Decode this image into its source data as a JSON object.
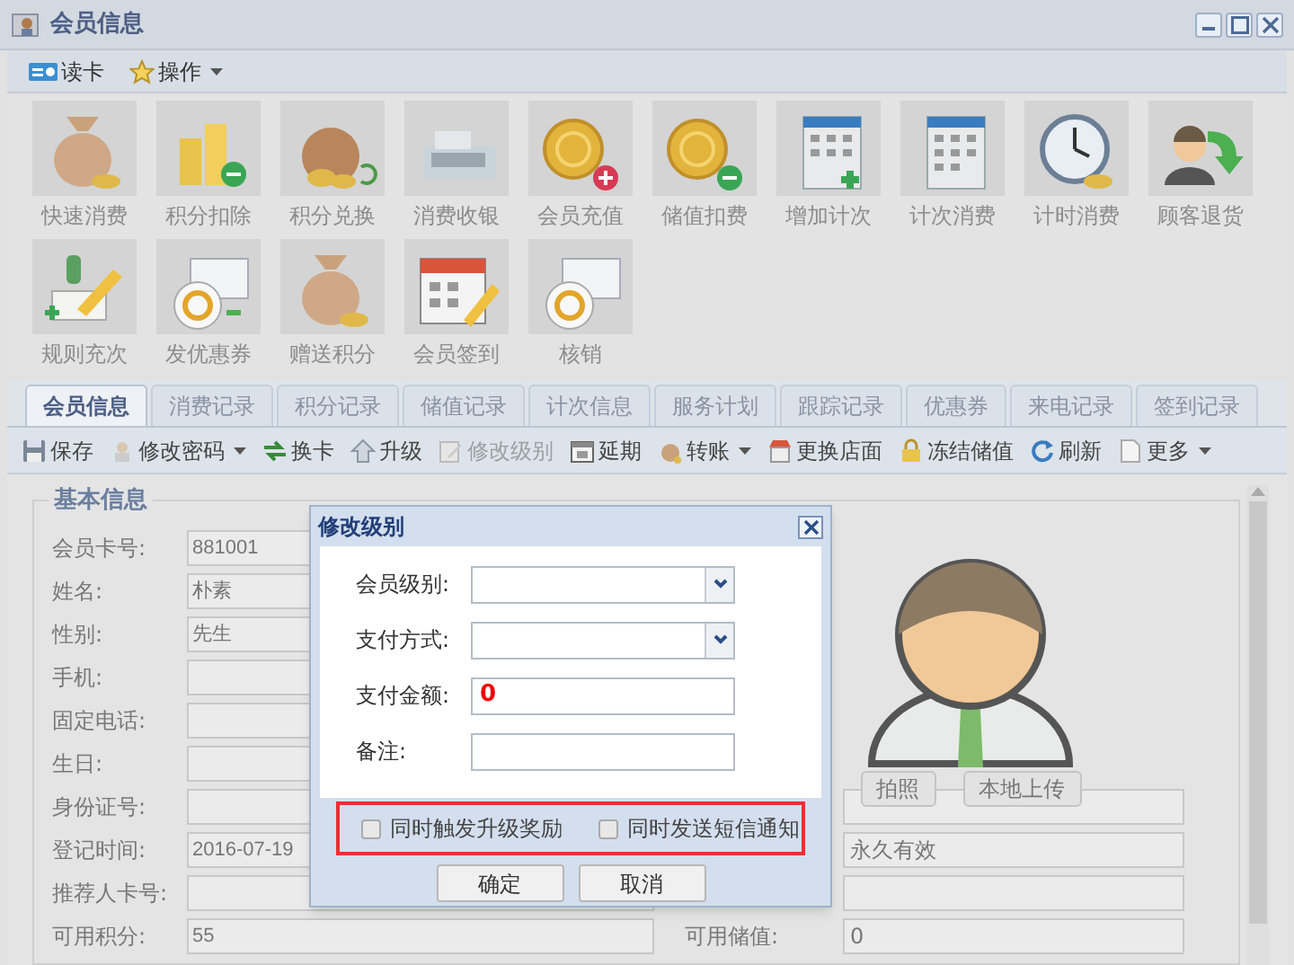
{
  "window": {
    "title": "会员信息"
  },
  "menu": [
    {
      "label": "读卡",
      "dropdown": false
    },
    {
      "label": "操作",
      "dropdown": true
    }
  ],
  "tiles": [
    {
      "label": "快速消费"
    },
    {
      "label": "积分扣除"
    },
    {
      "label": "积分兑换"
    },
    {
      "label": "消费收银"
    },
    {
      "label": "会员充值"
    },
    {
      "label": "储值扣费"
    },
    {
      "label": "增加计次"
    },
    {
      "label": "计次消费"
    },
    {
      "label": "计时消费"
    },
    {
      "label": "顾客退货"
    },
    {
      "label": "规则充次"
    },
    {
      "label": "发优惠券"
    },
    {
      "label": "赠送积分"
    },
    {
      "label": "会员签到"
    },
    {
      "label": "核销"
    }
  ],
  "tabs": [
    {
      "label": "会员信息",
      "selected": true
    },
    {
      "label": "消费记录",
      "selected": false
    },
    {
      "label": "积分记录",
      "selected": false
    },
    {
      "label": "储值记录",
      "selected": false
    },
    {
      "label": "计次信息",
      "selected": false
    },
    {
      "label": "服务计划",
      "selected": false
    },
    {
      "label": "跟踪记录",
      "selected": false
    },
    {
      "label": "优惠券",
      "selected": false
    },
    {
      "label": "来电记录",
      "selected": false
    },
    {
      "label": "签到记录",
      "selected": false
    }
  ],
  "actions": [
    {
      "label": "保存",
      "disabled": false,
      "dropdown": false
    },
    {
      "label": "修改密码",
      "disabled": false,
      "dropdown": true
    },
    {
      "label": "换卡",
      "disabled": false,
      "dropdown": false
    },
    {
      "label": "升级",
      "disabled": false,
      "dropdown": false
    },
    {
      "label": "修改级别",
      "disabled": true,
      "dropdown": false
    },
    {
      "label": "延期",
      "disabled": false,
      "dropdown": false
    },
    {
      "label": "转账",
      "disabled": false,
      "dropdown": true
    },
    {
      "label": "更换店面",
      "disabled": false,
      "dropdown": false
    },
    {
      "label": "冻结储值",
      "disabled": false,
      "dropdown": false
    },
    {
      "label": "刷新",
      "disabled": false,
      "dropdown": false
    },
    {
      "label": "更多",
      "disabled": false,
      "dropdown": true
    }
  ],
  "section_title": "基本信息",
  "fields": [
    {
      "label": "会员卡号:",
      "value": "881001"
    },
    {
      "label": "姓名:",
      "value": "朴素"
    },
    {
      "label": "性别:",
      "value": "先生"
    },
    {
      "label": "手机:"
    },
    {
      "label": "固定电话:"
    },
    {
      "label": "生日:"
    },
    {
      "label": "身份证号:",
      "right_input": true
    },
    {
      "label": "登记时间:",
      "value": "2016-07-19",
      "right_input": true,
      "right_value": "永久有效"
    },
    {
      "label": "推荐人卡号:",
      "right_input": true
    },
    {
      "label": "可用积分:",
      "value": "55",
      "right_input": true,
      "right_label": "可用储值:",
      "right_value": "0"
    }
  ],
  "photo_buttons": [
    "拍照",
    "本地上传"
  ],
  "dialog": {
    "title": "修改级别",
    "fields": [
      {
        "label": "会员级别:",
        "kind": "select"
      },
      {
        "label": "支付方式:",
        "kind": "select"
      },
      {
        "label": "支付金额:",
        "kind": "input",
        "value": "0"
      },
      {
        "label": "备注:",
        "kind": "input"
      }
    ],
    "checkboxes": [
      {
        "label": "同时触发升级奖励",
        "checked": false
      },
      {
        "label": "同时发送短信通知",
        "checked": false
      }
    ],
    "buttons": [
      "确定",
      "取消"
    ]
  }
}
